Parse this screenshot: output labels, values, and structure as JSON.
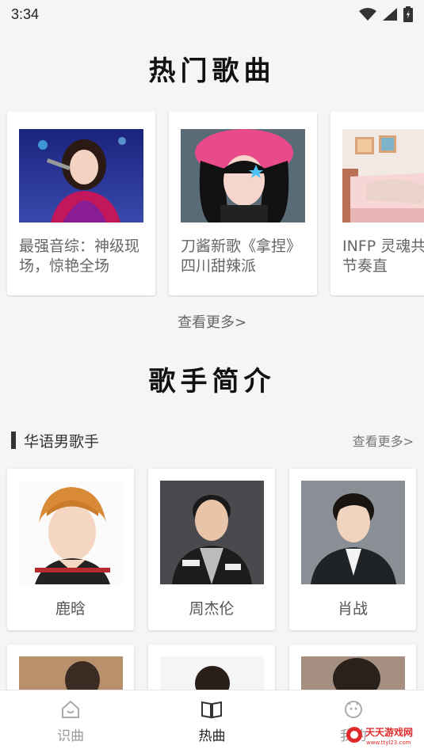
{
  "status_bar": {
    "time": "3:34",
    "icons": [
      "wifi-icon",
      "signal-icon",
      "battery-icon"
    ]
  },
  "hot_songs": {
    "title": "热门歌曲",
    "cards": [
      {
        "caption": "最强音综：神级现场，惊艳全场"
      },
      {
        "caption": "刀酱新歌《拿捏》 四川甜辣派"
      },
      {
        "caption": "INFP 灵魂共鸣 轻缓节奏直"
      }
    ],
    "see_more": "查看更多>"
  },
  "singers": {
    "title": "歌手简介",
    "category": {
      "title": "华语男歌手",
      "see_more": "查看更多>"
    },
    "row1": [
      {
        "name": "鹿晗"
      },
      {
        "name": "周杰伦"
      },
      {
        "name": "肖战"
      }
    ]
  },
  "tab_bar": {
    "tabs": [
      {
        "label": "识曲",
        "icon": "home-icon"
      },
      {
        "label": "热曲",
        "icon": "book-icon"
      },
      {
        "label": "我的",
        "icon": "face-icon"
      }
    ],
    "active_index": 1
  },
  "watermark": {
    "text": "天天游戏网",
    "url_text": "www.ttyl23.com"
  },
  "colors": {
    "background": "#f5f5f7",
    "card": "#ffffff",
    "watermark_red": "#e02a2a"
  }
}
